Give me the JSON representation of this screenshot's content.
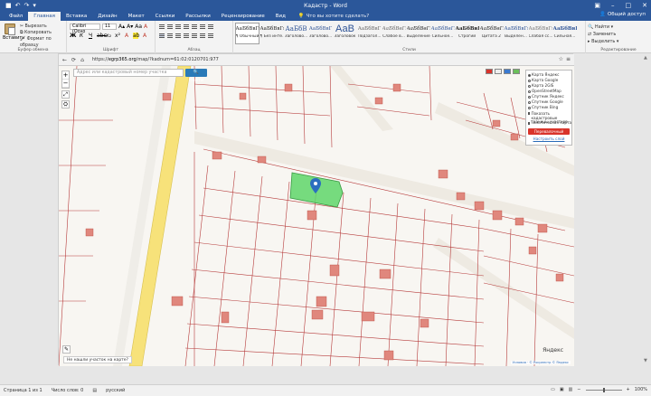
{
  "window": {
    "title": "Кадастр - Word",
    "share_label": "Общий доступ"
  },
  "ribbon_tabs": [
    {
      "label": "Файл"
    },
    {
      "label": "Главная"
    },
    {
      "label": "Вставка"
    },
    {
      "label": "Дизайн"
    },
    {
      "label": "Макет"
    },
    {
      "label": "Ссылки"
    },
    {
      "label": "Рассылки"
    },
    {
      "label": "Рецензирование"
    },
    {
      "label": "Вид"
    }
  ],
  "tell_me": "Что вы хотите сделать?",
  "clipboard": {
    "paste_label": "Вставить",
    "cut_label": "Вырезать",
    "copy_label": "Копировать",
    "format_painter_label": "Формат по образцу",
    "group_label": "Буфер обмена"
  },
  "font": {
    "name": "Calibri (Осно",
    "size": "11",
    "group_label": "Шрифт"
  },
  "paragraph": {
    "group_label": "Абзац"
  },
  "styles": {
    "group_label": "Стили",
    "items": [
      {
        "sample": "АаБбВвГг",
        "name": "¶ Обычный"
      },
      {
        "sample": "АаБбВвГг",
        "name": "¶ Без инте..."
      },
      {
        "sample": "АаБбВ",
        "name": "Заголово..."
      },
      {
        "sample": "АаБбВвГ",
        "name": "Заголово..."
      },
      {
        "sample": "АаВ",
        "name": "Заголовок"
      },
      {
        "sample": "АаБбВвГ",
        "name": "Подзагол..."
      },
      {
        "sample": "АаБбВвГг",
        "name": "Слабое в..."
      },
      {
        "sample": "АаБбВвГг",
        "name": "Выделение"
      },
      {
        "sample": "АаБбВвГг",
        "name": "Сильное..."
      },
      {
        "sample": "АаБбВвГг",
        "name": "Строгий"
      },
      {
        "sample": "АаБбВвГг",
        "name": "Цитата 2"
      },
      {
        "sample": "АаБбВвГг",
        "name": "Выделен..."
      },
      {
        "sample": "АаБбВвГг",
        "name": "Слабая сс..."
      },
      {
        "sample": "АаБбВвГг",
        "name": "Сильная..."
      }
    ]
  },
  "editing": {
    "find_label": "Найти",
    "replace_label": "Заменить",
    "select_label": "Выделить",
    "group_label": "Редактирование"
  },
  "browser": {
    "url_prefix": "https://",
    "url_domain": "egrp365.org",
    "url_rest": "/map/?kadnum=61:02:0120701:977"
  },
  "map": {
    "search_placeholder": "Адрес или кадастровый номер участка",
    "find_button": "Найти",
    "layers": {
      "options": [
        {
          "label": "Карта Яндекс",
          "on": true
        },
        {
          "label": "Карта Google",
          "on": false
        },
        {
          "label": "Карта 2GIS",
          "on": false
        },
        {
          "label": "OpenStreetMap",
          "on": false
        },
        {
          "label": "Спутник Яндекс",
          "on": false
        },
        {
          "label": "Спутник Google",
          "on": false
        },
        {
          "label": "Спутник Bing",
          "on": false
        }
      ],
      "checks": [
        {
          "label": "Показать кадастровые границы участков",
          "on": true
        },
        {
          "label": "Тематическая карта",
          "on": false
        }
      ],
      "red_button": "Перевалочный сегмент",
      "link": "Настроить слой"
    },
    "not_found_label": "Не нашли участок на карте?",
    "provider_label": "Яндекс",
    "attribution": "Условия · © Росреестр © Яндекс"
  },
  "status": {
    "page": "Страница 1 из 1",
    "words": "Число слов: 0",
    "language": "русский",
    "zoom": "100%"
  },
  "colors": {
    "word_blue": "#2b579a",
    "selected_parcel": "#5fd66a",
    "building": "#e0877d",
    "parcel_line": "#b63b3b",
    "marker": "#2c6fbf"
  }
}
